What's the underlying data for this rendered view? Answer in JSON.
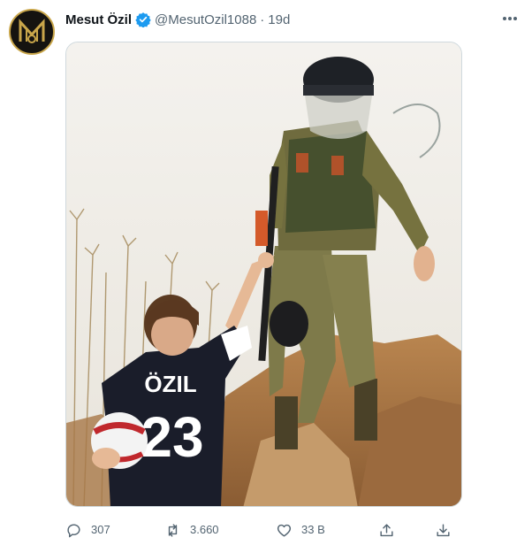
{
  "tweet": {
    "author_name": "Mesut Özil",
    "handle": "@MesutOzil1088",
    "separator": "·",
    "time": "19d",
    "shirt_name": "ÖZIL",
    "shirt_number": "23"
  },
  "actions": {
    "reply_count": "307",
    "retweet_count": "3.660",
    "like_count": "33 B"
  },
  "colors": {
    "accent": "#1d9bf0",
    "muted": "#536471",
    "avatar_gold": "#c9a64a"
  },
  "icons": [
    "verified-badge-icon",
    "more-icon",
    "reply-icon",
    "retweet-icon",
    "like-icon",
    "share-icon",
    "download-icon"
  ]
}
